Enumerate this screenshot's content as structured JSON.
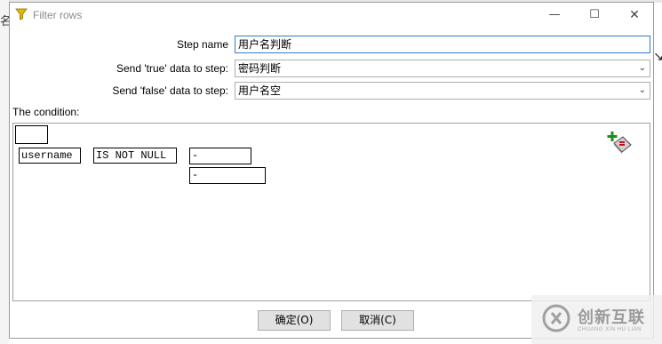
{
  "window": {
    "title": "Filter rows",
    "controls": {
      "minimize": "—",
      "maximize": "☐",
      "close": "✕"
    }
  },
  "form": {
    "step_name_label": "Step name",
    "step_name_value": "用户名判断",
    "true_label": "Send 'true' data to step:",
    "true_value": "密码判断",
    "false_label": "Send 'false' data to step:",
    "false_value": "用户名空"
  },
  "condition": {
    "label": "The condition:",
    "field": "username",
    "operator": "IS NOT NULL",
    "value1": "-",
    "value2": "-"
  },
  "buttons": {
    "ok": "确定(O)",
    "cancel": "取消(C)"
  },
  "background": {
    "left_char": "名",
    "right_glyph": "↘"
  },
  "watermark": {
    "text": "创新互联",
    "sub": "CHUANG XIN HU LIAN"
  }
}
